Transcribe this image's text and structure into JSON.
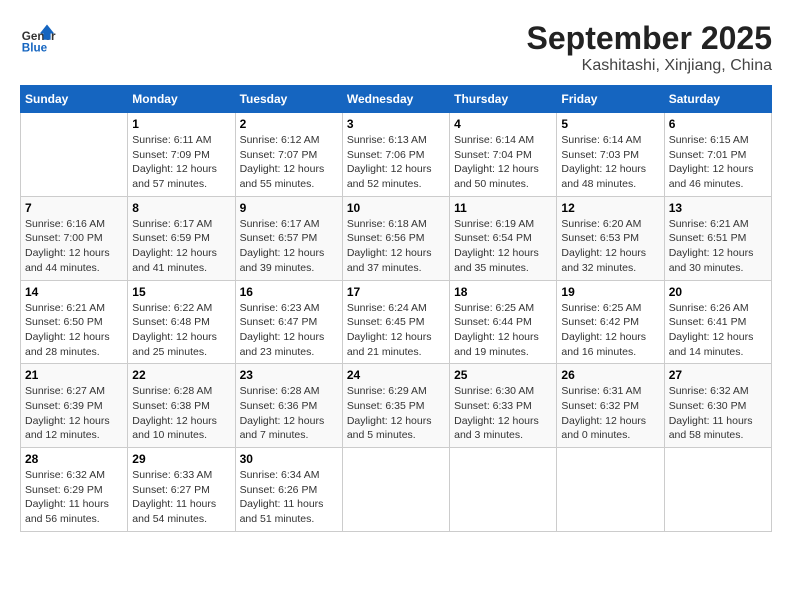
{
  "header": {
    "logo_general": "General",
    "logo_blue": "Blue",
    "month": "September 2025",
    "location": "Kashitashi, Xinjiang, China"
  },
  "weekdays": [
    "Sunday",
    "Monday",
    "Tuesday",
    "Wednesday",
    "Thursday",
    "Friday",
    "Saturday"
  ],
  "weeks": [
    [
      {
        "day": "",
        "info": ""
      },
      {
        "day": "1",
        "info": "Sunrise: 6:11 AM\nSunset: 7:09 PM\nDaylight: 12 hours\nand 57 minutes."
      },
      {
        "day": "2",
        "info": "Sunrise: 6:12 AM\nSunset: 7:07 PM\nDaylight: 12 hours\nand 55 minutes."
      },
      {
        "day": "3",
        "info": "Sunrise: 6:13 AM\nSunset: 7:06 PM\nDaylight: 12 hours\nand 52 minutes."
      },
      {
        "day": "4",
        "info": "Sunrise: 6:14 AM\nSunset: 7:04 PM\nDaylight: 12 hours\nand 50 minutes."
      },
      {
        "day": "5",
        "info": "Sunrise: 6:14 AM\nSunset: 7:03 PM\nDaylight: 12 hours\nand 48 minutes."
      },
      {
        "day": "6",
        "info": "Sunrise: 6:15 AM\nSunset: 7:01 PM\nDaylight: 12 hours\nand 46 minutes."
      }
    ],
    [
      {
        "day": "7",
        "info": "Sunrise: 6:16 AM\nSunset: 7:00 PM\nDaylight: 12 hours\nand 44 minutes."
      },
      {
        "day": "8",
        "info": "Sunrise: 6:17 AM\nSunset: 6:59 PM\nDaylight: 12 hours\nand 41 minutes."
      },
      {
        "day": "9",
        "info": "Sunrise: 6:17 AM\nSunset: 6:57 PM\nDaylight: 12 hours\nand 39 minutes."
      },
      {
        "day": "10",
        "info": "Sunrise: 6:18 AM\nSunset: 6:56 PM\nDaylight: 12 hours\nand 37 minutes."
      },
      {
        "day": "11",
        "info": "Sunrise: 6:19 AM\nSunset: 6:54 PM\nDaylight: 12 hours\nand 35 minutes."
      },
      {
        "day": "12",
        "info": "Sunrise: 6:20 AM\nSunset: 6:53 PM\nDaylight: 12 hours\nand 32 minutes."
      },
      {
        "day": "13",
        "info": "Sunrise: 6:21 AM\nSunset: 6:51 PM\nDaylight: 12 hours\nand 30 minutes."
      }
    ],
    [
      {
        "day": "14",
        "info": "Sunrise: 6:21 AM\nSunset: 6:50 PM\nDaylight: 12 hours\nand 28 minutes."
      },
      {
        "day": "15",
        "info": "Sunrise: 6:22 AM\nSunset: 6:48 PM\nDaylight: 12 hours\nand 25 minutes."
      },
      {
        "day": "16",
        "info": "Sunrise: 6:23 AM\nSunset: 6:47 PM\nDaylight: 12 hours\nand 23 minutes."
      },
      {
        "day": "17",
        "info": "Sunrise: 6:24 AM\nSunset: 6:45 PM\nDaylight: 12 hours\nand 21 minutes."
      },
      {
        "day": "18",
        "info": "Sunrise: 6:25 AM\nSunset: 6:44 PM\nDaylight: 12 hours\nand 19 minutes."
      },
      {
        "day": "19",
        "info": "Sunrise: 6:25 AM\nSunset: 6:42 PM\nDaylight: 12 hours\nand 16 minutes."
      },
      {
        "day": "20",
        "info": "Sunrise: 6:26 AM\nSunset: 6:41 PM\nDaylight: 12 hours\nand 14 minutes."
      }
    ],
    [
      {
        "day": "21",
        "info": "Sunrise: 6:27 AM\nSunset: 6:39 PM\nDaylight: 12 hours\nand 12 minutes."
      },
      {
        "day": "22",
        "info": "Sunrise: 6:28 AM\nSunset: 6:38 PM\nDaylight: 12 hours\nand 10 minutes."
      },
      {
        "day": "23",
        "info": "Sunrise: 6:28 AM\nSunset: 6:36 PM\nDaylight: 12 hours\nand 7 minutes."
      },
      {
        "day": "24",
        "info": "Sunrise: 6:29 AM\nSunset: 6:35 PM\nDaylight: 12 hours\nand 5 minutes."
      },
      {
        "day": "25",
        "info": "Sunrise: 6:30 AM\nSunset: 6:33 PM\nDaylight: 12 hours\nand 3 minutes."
      },
      {
        "day": "26",
        "info": "Sunrise: 6:31 AM\nSunset: 6:32 PM\nDaylight: 12 hours\nand 0 minutes."
      },
      {
        "day": "27",
        "info": "Sunrise: 6:32 AM\nSunset: 6:30 PM\nDaylight: 11 hours\nand 58 minutes."
      }
    ],
    [
      {
        "day": "28",
        "info": "Sunrise: 6:32 AM\nSunset: 6:29 PM\nDaylight: 11 hours\nand 56 minutes."
      },
      {
        "day": "29",
        "info": "Sunrise: 6:33 AM\nSunset: 6:27 PM\nDaylight: 11 hours\nand 54 minutes."
      },
      {
        "day": "30",
        "info": "Sunrise: 6:34 AM\nSunset: 6:26 PM\nDaylight: 11 hours\nand 51 minutes."
      },
      {
        "day": "",
        "info": ""
      },
      {
        "day": "",
        "info": ""
      },
      {
        "day": "",
        "info": ""
      },
      {
        "day": "",
        "info": ""
      }
    ]
  ]
}
